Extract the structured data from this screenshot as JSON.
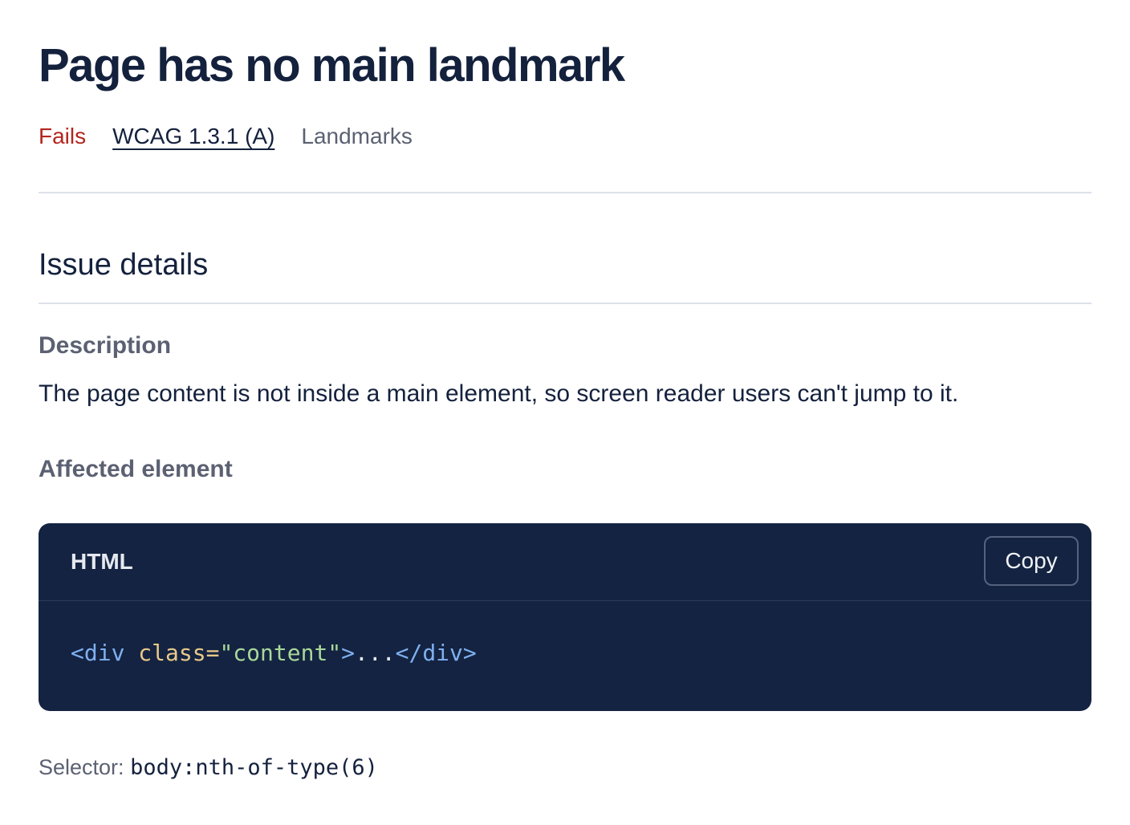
{
  "issue": {
    "title": "Page has no main landmark",
    "status": "Fails",
    "wcag_link": "WCAG 1.3.1 (A)",
    "category": "Landmarks"
  },
  "details": {
    "section_title": "Issue details",
    "description_label": "Description",
    "description_text": "The page content is not inside a main element, so screen reader users can't jump to it.",
    "affected_label": "Affected element"
  },
  "code": {
    "language": "HTML",
    "copy_label": "Copy",
    "tokens": {
      "open_tag": "<div",
      "attr_name": "class=",
      "attr_value": "\"content\"",
      "open_close": ">",
      "inner_text": "...",
      "close_tag": "</div>"
    }
  },
  "selector": {
    "label": "Selector:",
    "value": "body:nth-of-type(6)"
  },
  "colors": {
    "fail": "#b3261e",
    "heading": "#14213d",
    "muted": "#5b6172",
    "code_bg": "#142341"
  }
}
